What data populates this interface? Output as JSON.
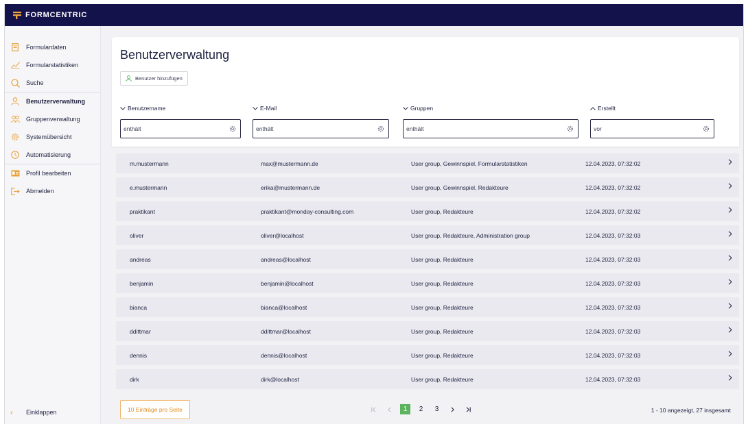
{
  "app": {
    "brand": "FORMCENTRIC"
  },
  "sidebar": {
    "items": [
      {
        "label": "Formulardaten",
        "icon": "document-icon"
      },
      {
        "label": "Formularstatistiken",
        "icon": "chart-line-icon"
      },
      {
        "label": "Suche",
        "icon": "search-icon"
      },
      {
        "label": "Benutzerverwaltung",
        "icon": "user-icon",
        "active": true
      },
      {
        "label": "Gruppenverwaltung",
        "icon": "users-icon"
      },
      {
        "label": "Systemübersicht",
        "icon": "gear-icon"
      },
      {
        "label": "Automatisierung",
        "icon": "clock-icon"
      },
      {
        "label": "Profil bearbeiten",
        "icon": "id-card-icon"
      },
      {
        "label": "Abmelden",
        "icon": "logout-icon"
      }
    ],
    "collapse_label": "Einklappen"
  },
  "page": {
    "title": "Benutzerverwaltung",
    "add_button": "Benutzer hinzufügen"
  },
  "columns": [
    {
      "label": "Benutzername",
      "sort": "down",
      "filter_placeholder": "enthält"
    },
    {
      "label": "E-Mail",
      "sort": "down",
      "filter_placeholder": "enthält"
    },
    {
      "label": "Gruppen",
      "sort": "down",
      "filter_placeholder": "enthält"
    },
    {
      "label": "Erstellt",
      "sort": "up",
      "filter_placeholder": "vor"
    }
  ],
  "rows": [
    {
      "username": "m.mustermann",
      "email": "max@mustermann.de",
      "groups": "User group, Gewinnspiel, Formularstatistiken",
      "created": "12.04.2023, 07:32:02"
    },
    {
      "username": "e.mustermann",
      "email": "erika@mustermann.de",
      "groups": "User group, Gewinnspiel, Redakteure",
      "created": "12.04.2023, 07:32:02"
    },
    {
      "username": "praktikant",
      "email": "praktikant@monday-consulting.com",
      "groups": "User group, Redakteure",
      "created": "12.04.2023, 07:32:02"
    },
    {
      "username": "oliver",
      "email": "oliver@localhost",
      "groups": "User group, Redakteure, Administration group",
      "created": "12.04.2023, 07:32:03"
    },
    {
      "username": "andreas",
      "email": "andreas@localhost",
      "groups": "User group, Redakteure",
      "created": "12.04.2023, 07:32:03"
    },
    {
      "username": "benjamin",
      "email": "benjamin@localhost",
      "groups": "User group, Redakteure",
      "created": "12.04.2023, 07:32:03"
    },
    {
      "username": "bianca",
      "email": "bianca@localhost",
      "groups": "User group, Redakteure",
      "created": "12.04.2023, 07:32:03"
    },
    {
      "username": "ddittmar",
      "email": "ddittmar@localhost",
      "groups": "User group, Redakteure",
      "created": "12.04.2023, 07:32:03"
    },
    {
      "username": "dennis",
      "email": "dennis@localhost",
      "groups": "User group, Redakteure",
      "created": "12.04.2023, 07:32:03"
    },
    {
      "username": "dirk",
      "email": "dirk@localhost",
      "groups": "User group, Redakteure",
      "created": "12.04.2023, 07:32:03"
    }
  ],
  "pagination": {
    "page_size_label": "10 Einträge pro Seite",
    "pages": [
      "1",
      "2",
      "3"
    ],
    "current_page": "1",
    "summary": "1 - 10 angezeigt, 27 insgesamt"
  },
  "colors": {
    "topbar": "#14124a",
    "accent_orange": "#e8a33a",
    "active_page": "#5bb35e"
  }
}
